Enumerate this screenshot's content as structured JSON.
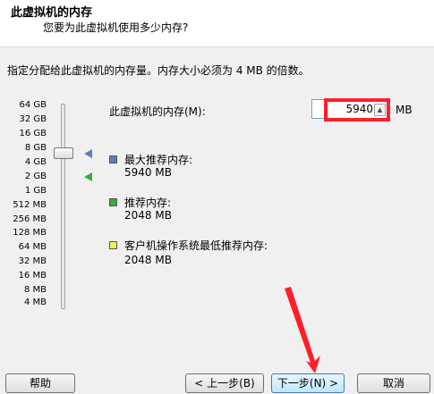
{
  "header": {
    "title": "此虚拟机的内存",
    "subtitle": "您要为此虚拟机使用多少内存?"
  },
  "instruction": "指定分配给此虚拟机的内存量。内存大小必须为 4 MB 的倍数。",
  "scale": {
    "ticks": [
      "64 GB",
      "32 GB",
      "16 GB",
      "8 GB",
      "4 GB",
      "2 GB",
      "1 GB",
      "512 MB",
      "256 MB",
      "128 MB",
      "64 MB",
      "32 MB",
      "16 MB",
      "8 MB",
      "4 MB"
    ]
  },
  "memory": {
    "label": "此虚拟机的内存(M):",
    "value": "5940",
    "unit": "MB",
    "slider_setting": "5940 MB"
  },
  "legend": [
    {
      "label": "最大推荐内存:",
      "value": "5940 MB",
      "color": "#5b7fc0"
    },
    {
      "label": "推荐内存:",
      "value": "2048 MB",
      "color": "#3ca83c"
    },
    {
      "label": "客户机操作系统最低推荐内存:",
      "value": "2048 MB",
      "color": "#f5f05a"
    }
  ],
  "buttons": {
    "help": "帮助",
    "back": "< 上一步(B)",
    "next": "下一步(N) >",
    "cancel": "取消"
  },
  "annotation_colors": {
    "highlight": "#ff1e2b",
    "arrow": "#ff1e2b"
  }
}
